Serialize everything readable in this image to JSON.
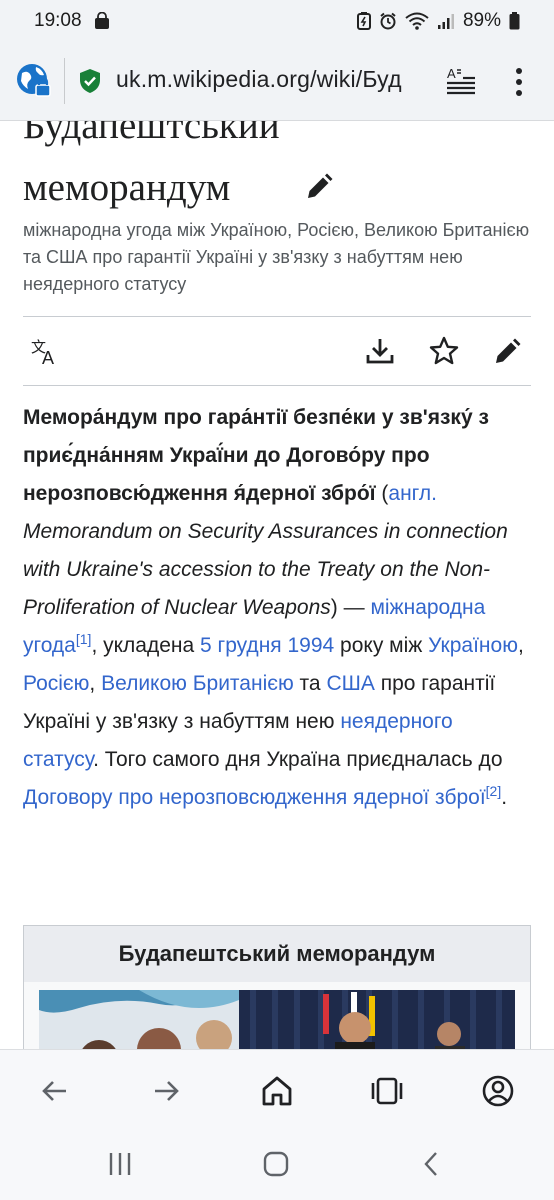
{
  "status_bar": {
    "time": "19:08",
    "battery_percent": "89%"
  },
  "browser": {
    "url": "uk.m.wikipedia.org/wiki/Буд",
    "icons": [
      "site-settings-icon",
      "secure-lock-icon",
      "reader-mode-icon",
      "more-vert-icon"
    ]
  },
  "article": {
    "title_line1": "Будапештський",
    "title_line2": "меморандум",
    "description": "міжнародна угода між Україною, Росією, Великою Британією та США про гарантії Україні у зв'язку з набуттям нею неядерного статусу",
    "toolbar_icons": [
      "language-icon",
      "download-icon",
      "star-icon",
      "edit-icon"
    ],
    "intro": {
      "bold": "Мемора́ндум про гара́нтії безпе́ки у зв'язку́ з приє́дна́нням Украї́ни до Догово́ру про нерозповсю́дження я́дерної збро́ї",
      "open_paren": " (",
      "lang_link": "англ.",
      "english": " Memorandum on Security Assurances in connection with Ukraine's accession to the Treaty on the Non-Proliferation of Nuclear Weapons",
      "close_dash": ") — ",
      "link_agreement": "міжнародна угода",
      "ref1": "[1]",
      "text1": ", укладена ",
      "link_date": "5 грудня 1994",
      "text2": " року між ",
      "link_ukraine": "Україною",
      "comma1": ", ",
      "link_russia": "Росією",
      "comma2": ", ",
      "link_uk": "Великою Британією",
      "text_and": " та ",
      "link_usa": "США",
      "text3": " про гарантії Україні у зв'язку з набуттям нею ",
      "link_status": "неядерного статусу",
      "text4": ". Того самого дня Україна приєдналась до ",
      "link_treaty": "Договору про нерозповсюдження ядерної зброї",
      "ref2": "[2]",
      "end": "."
    },
    "infobox_title": "Будапештський меморандум"
  },
  "bottom_nav": [
    "back-icon",
    "forward-icon",
    "home-icon",
    "tabs-icon",
    "account-icon"
  ],
  "system_nav": [
    "recents-icon",
    "home-button-icon",
    "back-button-icon"
  ],
  "colors": {
    "link": "#3366cc",
    "text": "#202122",
    "muted": "#54595d",
    "bar": "#f1f3f6"
  }
}
